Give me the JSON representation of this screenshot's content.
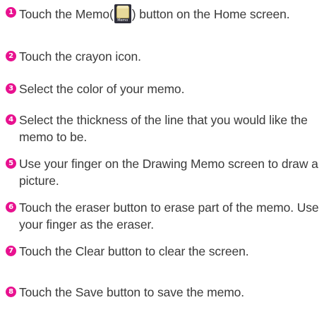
{
  "steps": [
    {
      "num": "1",
      "text_before_icon": "Touch the Memo(",
      "text_after_icon": ") button on the Home screen."
    },
    {
      "num": "2",
      "text": "Touch the crayon icon."
    },
    {
      "num": "3",
      "text": "Select the color of your memo."
    },
    {
      "num": "4",
      "text": "Select the thickness of the line that you would like the memo to be."
    },
    {
      "num": "5",
      "text": "Use your finger on the Drawing Memo screen to draw a picture."
    },
    {
      "num": "6",
      "text": "Touch the eraser button to erase part of the memo. Use your finger as the eraser."
    },
    {
      "num": "7",
      "text": "Touch the Clear button to clear the screen."
    },
    {
      "num": "8",
      "text": "Touch the Save button to save the memo."
    }
  ],
  "memo_icon": {
    "icon": "memo-app-icon",
    "caption": "Memo",
    "colors": {
      "background": "#2e2e3a",
      "pad": "#e7d89a",
      "pad_shadow": "#b9a85e"
    }
  },
  "colors": {
    "step_badge": "#e8118f",
    "text": "#3a3a3a"
  }
}
